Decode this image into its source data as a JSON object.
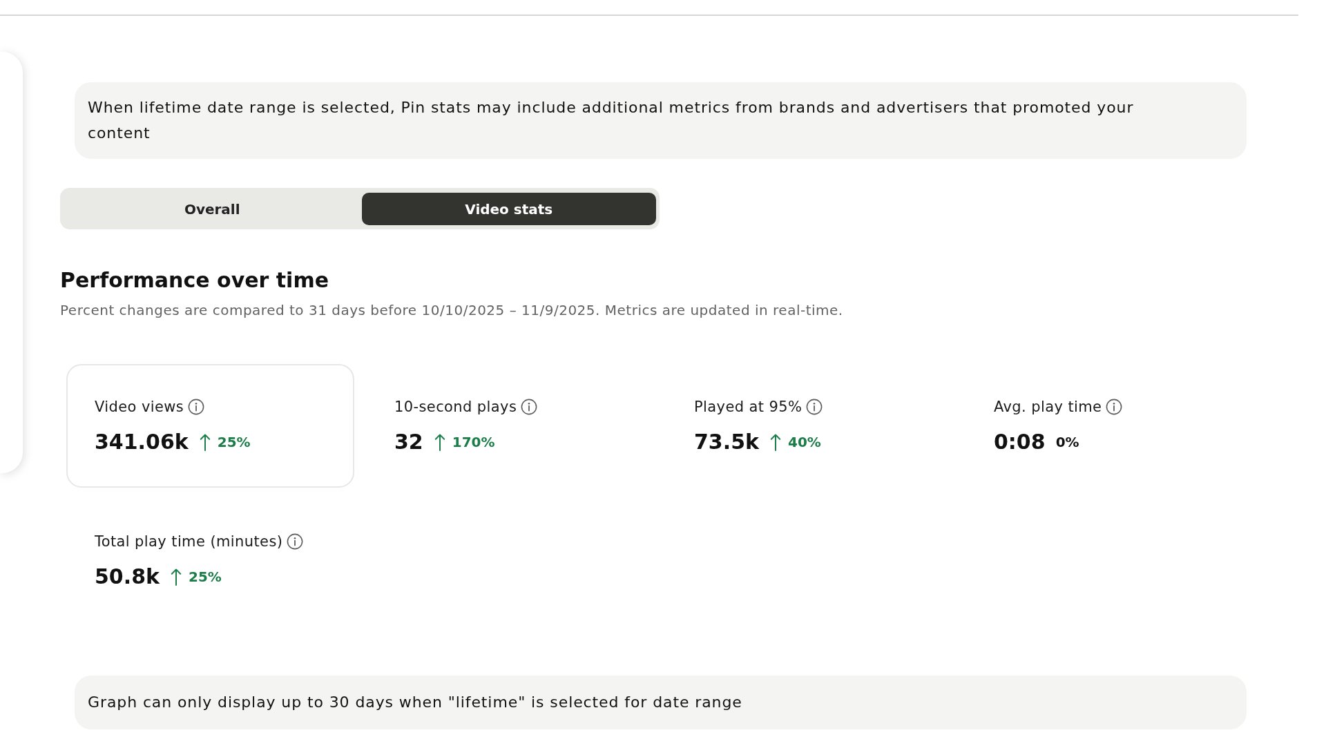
{
  "notice": {
    "text": "When lifetime date range is selected, Pin stats may include additional metrics from brands and advertisers that promoted your content"
  },
  "tabs": [
    {
      "label": "Overall",
      "selected": false
    },
    {
      "label": "Video stats",
      "selected": true
    }
  ],
  "section": {
    "title": "Performance over time",
    "subtitle": "Percent changes are compared to 31 days before 10/10/2025 – 11/9/2025. Metrics are updated in real-time."
  },
  "metrics": [
    {
      "label": "Video views",
      "value": "341.06k",
      "change": "25%",
      "increase": true,
      "selected": true
    },
    {
      "label": "10-second plays",
      "value": "32",
      "change": "170%",
      "increase": true,
      "selected": false
    },
    {
      "label": "Played at 95%",
      "value": "73.5k",
      "change": "40%",
      "increase": true,
      "selected": false
    },
    {
      "label": "Avg. play time",
      "value": "0:08",
      "change": "0%",
      "increase": false,
      "selected": false
    },
    {
      "label": "Total play time (minutes)",
      "value": "50.8k",
      "change": "25%",
      "increase": true,
      "selected": false
    }
  ],
  "footer_notice": {
    "text": "Graph can only display up to 30 days when \"lifetime\" is selected for date range"
  }
}
